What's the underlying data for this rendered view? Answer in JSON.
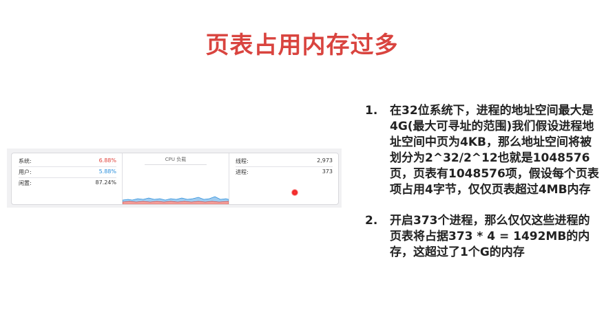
{
  "title": "页表占用内存过多",
  "monitor": {
    "left_stats": [
      {
        "label": "系统:",
        "value": "6.88%",
        "color": "#e0433c"
      },
      {
        "label": "用户:",
        "value": "5.88%",
        "color": "#2a8fdc"
      },
      {
        "label": "闲置:",
        "value": "87.24%",
        "color": "#333333"
      }
    ],
    "cpu_title": "CPU 负载",
    "right_stats": [
      {
        "label": "线程:",
        "value": "2,973"
      },
      {
        "label": "进程:",
        "value": "373"
      }
    ]
  },
  "points": [
    {
      "num": "1.",
      "text": "在32位系统下，进程的地址空间最大是4G(最大可寻址的范围)我们假设进程地址空间中页为4KB，那么地址空间将被划分为2^32/2^12也就是1048576页，页表有1048576项，假设每个页表项占用4字节，仅仅页表超过4MB内存"
    },
    {
      "num": "2.",
      "text": "开启373个进程，那么仅仅这些进程的页表将占据373 * 4 = 1492MB的内存，这超过了1个G的内存"
    }
  ]
}
